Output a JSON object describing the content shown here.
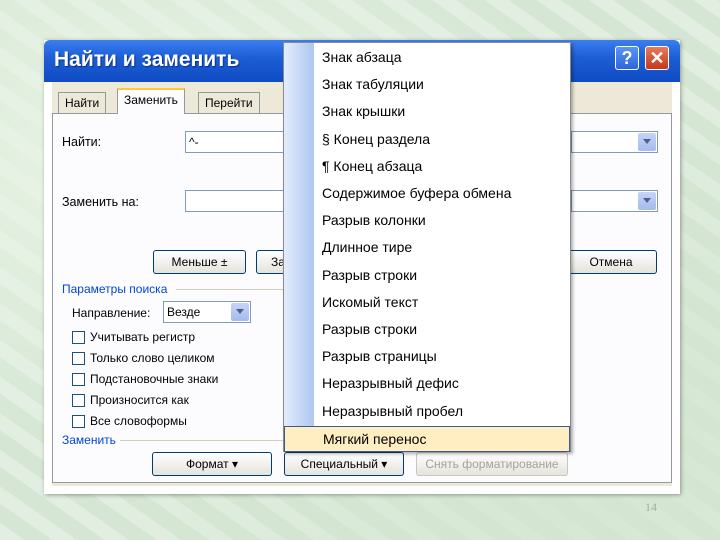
{
  "dialog": {
    "title": "Найти и заменить",
    "help_label": "?",
    "close_label": "✕",
    "tabs": [
      {
        "label": "Найти"
      },
      {
        "label": "Заменить"
      },
      {
        "label": "Перейти"
      }
    ],
    "find_label": "Найти:",
    "find_value": "^-",
    "replace_label": "Заменить на:",
    "replace_value": "",
    "less_button": "Меньше ±",
    "partial_button": "За",
    "cancel_button": "Отмена",
    "search_params_title": "Параметры поиска",
    "direction_label": "Направление:",
    "direction_value": "Везде",
    "checkboxes": [
      {
        "label": "Учитывать регистр"
      },
      {
        "label": "Только слово целиком"
      },
      {
        "label": "Подстановочные знаки"
      },
      {
        "label": "Произносится как"
      },
      {
        "label": "Все словоформы"
      }
    ],
    "replace_section_title": "Заменить",
    "format_button": "Формат ▾",
    "special_button": "Специальный ▾",
    "clear_format_button": "Снять форматирование"
  },
  "special_menu": {
    "items": [
      {
        "label": "Знак абзаца"
      },
      {
        "label": "Знак табуляции"
      },
      {
        "label": "Знак крышки"
      },
      {
        "label": "§ Конец раздела"
      },
      {
        "label": "¶ Конец абзаца"
      },
      {
        "label": "Содержимое буфера обмена"
      },
      {
        "label": "Разрыв колонки"
      },
      {
        "label": "Длинное тире"
      },
      {
        "label": "Разрыв строки"
      },
      {
        "label": "Искомый текст"
      },
      {
        "label": "Разрыв строки"
      },
      {
        "label": "Разрыв страницы"
      },
      {
        "label": "Неразрывный дефис"
      },
      {
        "label": "Неразрывный пробел"
      },
      {
        "label": "Мягкий перенос"
      }
    ],
    "highlighted_index": 14
  },
  "page_number": "14"
}
